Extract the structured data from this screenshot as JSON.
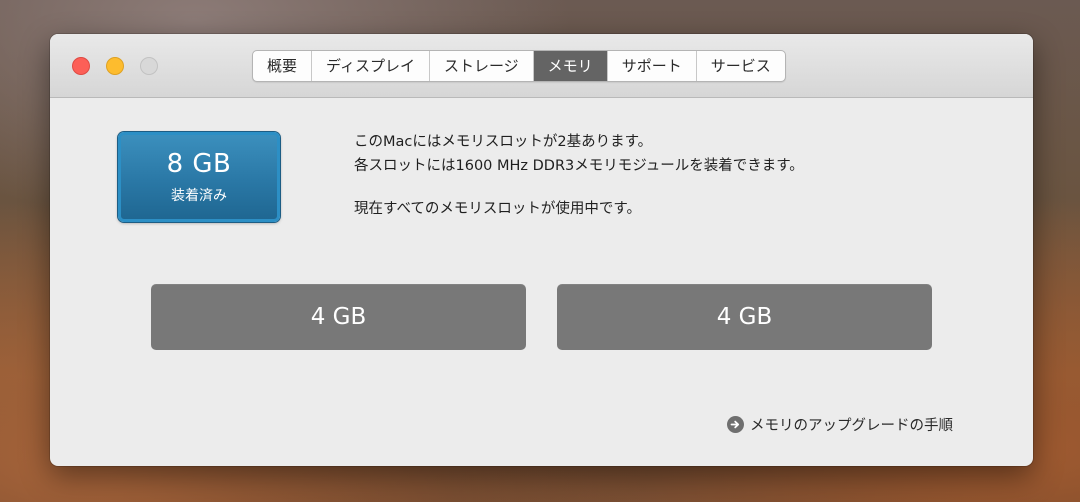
{
  "tabs": [
    {
      "label": "概要",
      "active": false
    },
    {
      "label": "ディスプレイ",
      "active": false
    },
    {
      "label": "ストレージ",
      "active": false
    },
    {
      "label": "メモリ",
      "active": true
    },
    {
      "label": "サポート",
      "active": false
    },
    {
      "label": "サービス",
      "active": false
    }
  ],
  "memory": {
    "total": "8 GB",
    "installed_label": "装着済み",
    "info_line_1": "このMacにはメモリスロットが2基あります。",
    "info_line_2": "各スロットには1600 MHz DDR3メモリモジュールを装着できます。",
    "info_line_3": "現在すべてのメモリスロットが使用中です。",
    "slots": [
      "4 GB",
      "4 GB"
    ]
  },
  "upgrade_link": "メモリのアップグレードの手順",
  "colors": {
    "active_tab": "#646464",
    "badge_blue": "#2a78a6",
    "slot_gray": "#787878",
    "close": "#fc5f57",
    "minimize": "#fdbc2e",
    "zoom_disabled": "#d8d8d8"
  },
  "icons": {
    "upgrade": "arrow-right-circle-icon"
  }
}
